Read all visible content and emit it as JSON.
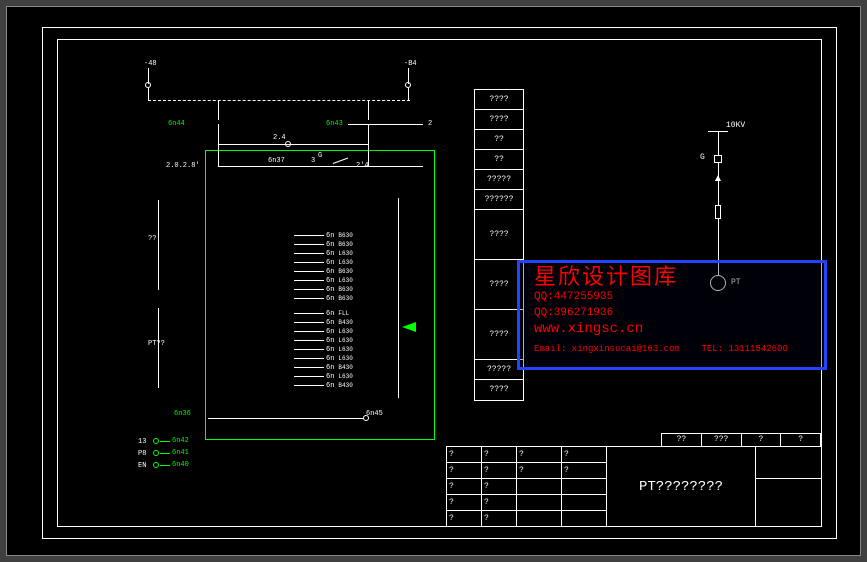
{
  "voltage_label": "10KV",
  "pt_label": "PT",
  "ground_label": "G",
  "top_refs": {
    "left": "-48",
    "right": "-B4"
  },
  "green_labels": {
    "n44": "6n44",
    "n43": "6n43",
    "n36": "6n36",
    "n42": "6n42",
    "n41": "6n41",
    "n40": "6n40"
  },
  "pt_side_label": "PT??",
  "side_question": "??",
  "fuse_label": "2.0.2.8'",
  "lamp_label": "2.4",
  "switch_labels": {
    "left": "6n37",
    "mid": "3",
    "right": "2'4"
  },
  "g_label": "G",
  "bottom_bus": "6n45",
  "bottom_prefixes": [
    "13",
    "P8",
    "EN"
  ],
  "terminal_rows": [
    "B630",
    "B630",
    "L630",
    "L630",
    "B630",
    "L630",
    "B630",
    "B630",
    "FLL",
    "B430",
    "L630",
    "L630",
    "L630",
    "L630",
    "B430",
    "L630",
    "B430"
  ],
  "terminal_prefix": "6n",
  "legend_rows": [
    "????",
    "????",
    "??",
    "??",
    "?????",
    "??????",
    "????",
    "????",
    "????",
    "?????",
    "????"
  ],
  "watermark": {
    "title": "星欣设计图库",
    "qq1": "QQ:447255935",
    "qq2": "QQ:396271936",
    "url": "www.xingsc.cn",
    "email": "Email: xingxinsucai@163.com",
    "tel": "TEL: 13111542600"
  },
  "titleblock": {
    "main": "PT????????",
    "top_extra": [
      "??",
      "???",
      "?",
      "?"
    ],
    "cells": [
      "?",
      "?",
      "?",
      "?",
      "?",
      "?",
      "?",
      "?",
      "?",
      "?",
      "?",
      "?",
      "?",
      "?",
      "?",
      "?"
    ]
  }
}
